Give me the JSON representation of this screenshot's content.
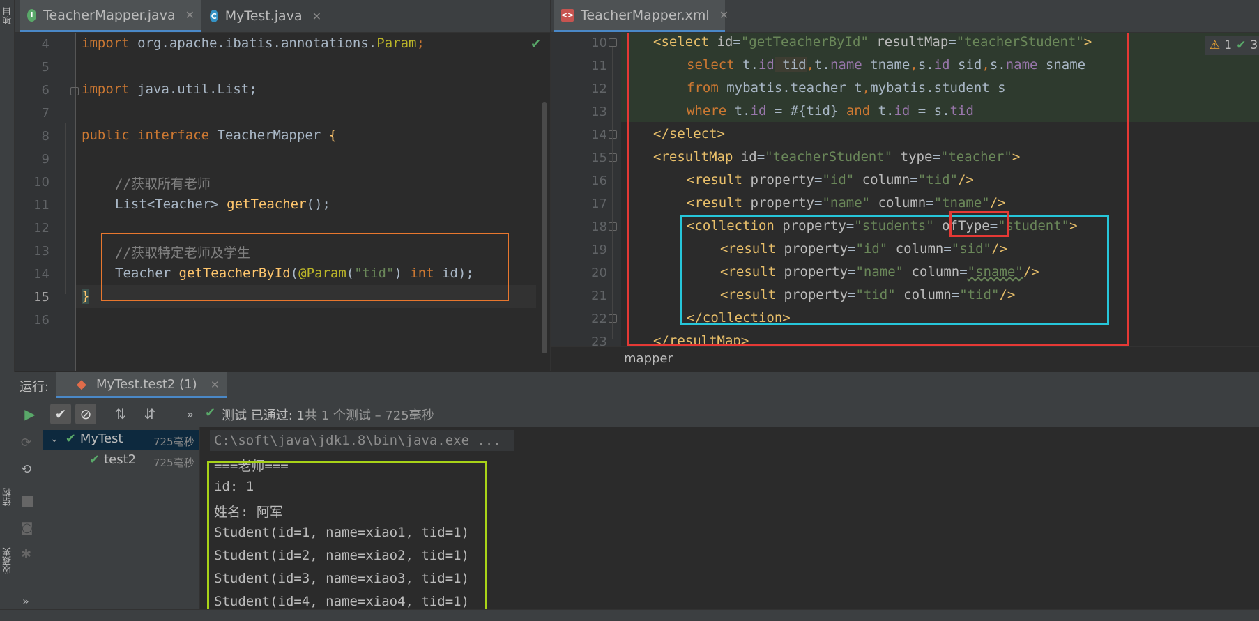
{
  "left_strip": {
    "top_label": "项目",
    "mid_label": "结构",
    "bottom_label": "收藏夹"
  },
  "left_editor": {
    "tabs": [
      {
        "label": "TeacherMapper.java",
        "badge": "I",
        "badge_color": "#59a869"
      },
      {
        "label": "MyTest.java",
        "badge": "C",
        "badge_color": "#3592c4"
      }
    ],
    "lines": [
      {
        "n": "4"
      },
      {
        "n": "5"
      },
      {
        "n": "6"
      },
      {
        "n": "7"
      },
      {
        "n": "8"
      },
      {
        "n": "9"
      },
      {
        "n": "10"
      },
      {
        "n": "11"
      },
      {
        "n": "12"
      },
      {
        "n": "13"
      },
      {
        "n": "14"
      },
      {
        "n": "15"
      },
      {
        "n": "16"
      }
    ],
    "code": {
      "l4_kw": "import",
      "l4_pkg": " org.apache.ibatis.annotations.",
      "l4_cls": "Param",
      "l4_semi": ";",
      "l6_kw": "import",
      "l6_rest": " java.util.List;",
      "l8_kw1": "public",
      "l8_kw2": "interface",
      "l8_name": " TeacherMapper ",
      "l8_brace": "{",
      "l10_cmt": "//获取所有老师",
      "l11_type": "List<Teacher> ",
      "l11_fn": "getTeacher",
      "l11_rest": "();",
      "l13_cmt": "//获取特定老师及学生",
      "l14_type": "Teacher ",
      "l14_fn": "getTeacherById",
      "l14_p1": "(",
      "l14_ann": "@Param",
      "l14_p2": "(",
      "l14_str": "\"tid\"",
      "l14_p3": ") ",
      "l14_kw": "int",
      "l14_rest": " id);",
      "l15_brace": "}"
    }
  },
  "right_editor": {
    "tab": {
      "label": "TeacherMapper.xml"
    },
    "inspections": {
      "warnings": "1",
      "passed": "3"
    },
    "lines": [
      {
        "n": "10"
      },
      {
        "n": "11"
      },
      {
        "n": "12"
      },
      {
        "n": "13"
      },
      {
        "n": "14"
      },
      {
        "n": "15"
      },
      {
        "n": "16"
      },
      {
        "n": "17"
      },
      {
        "n": "18"
      },
      {
        "n": "19"
      },
      {
        "n": "20"
      },
      {
        "n": "21"
      },
      {
        "n": "22"
      },
      {
        "n": "23"
      }
    ],
    "code": {
      "r10": [
        "<select ",
        "id",
        "=",
        "\"getTeacherById\"",
        " resultMap",
        "=",
        "\"teacherStudent\"",
        ">"
      ],
      "r11": [
        "select ",
        "t.",
        "id",
        " tid",
        ",",
        "t.",
        "name",
        " tname",
        ",",
        "s.",
        "id",
        " sid",
        ",",
        "s.",
        "name",
        " sname"
      ],
      "r12": [
        "from ",
        "mybatis.teacher t",
        ",",
        "mybatis.student s"
      ],
      "r13": [
        "where ",
        "t.",
        "id",
        " = #{tid} ",
        "and ",
        "t.",
        "id",
        " = s.",
        "tid"
      ],
      "r14": "</select>",
      "r15": [
        "<resultMap ",
        "id",
        "=",
        "\"teacherStudent\"",
        " type",
        "=",
        "\"teacher\"",
        ">"
      ],
      "r16": [
        "<result ",
        "property",
        "=",
        "\"id\"",
        " column",
        "=",
        "\"tid\"",
        "/>"
      ],
      "r17": [
        "<result ",
        "property",
        "=",
        "\"name\"",
        " column",
        "=",
        "\"tname\"",
        "/>"
      ],
      "r18": [
        "<collection ",
        "property",
        "=",
        "\"students\"",
        " ofType",
        "=",
        "\"student\"",
        ">"
      ],
      "r19": [
        "<result ",
        "property",
        "=",
        "\"id\"",
        " column",
        "=",
        "\"sid\"",
        "/>"
      ],
      "r20": [
        "<result ",
        "property",
        "=",
        "\"name\"",
        " column",
        "=",
        "\"sname\"",
        "/>"
      ],
      "r21": [
        "<result ",
        "property",
        "=",
        "\"tid\"",
        " column",
        "=",
        "\"tid\"",
        "/>"
      ],
      "r22": "</collection>",
      "r23": "</resultMap>"
    },
    "breadcrumb": "mapper"
  },
  "run_panel": {
    "label": "运行:",
    "config_tab": "MyTest.test2 (1)",
    "status_text_1": "测试 已通过: ",
    "status_count": "1",
    "status_text_2": "共 1 个测试 – 725毫秒",
    "tree": [
      {
        "label": "MyTest",
        "time": "725毫秒"
      },
      {
        "label": "test2",
        "time": "725毫秒"
      }
    ],
    "console": [
      "C:\\soft\\java\\jdk1.8\\bin\\java.exe ...",
      "===老师===",
      "id: 1",
      "姓名: 阿军",
      "Student(id=1, name=xiao1, tid=1)",
      "Student(id=2, name=xiao2, tid=1)",
      "Student(id=3, name=xiao3, tid=1)",
      "Student(id=4, name=xiao4, tid=1)"
    ]
  },
  "colors": {
    "orange_box": "#e8772e",
    "red_box": "#e53935",
    "cyan_box": "#26c6da",
    "green_box": "#a8d318",
    "pass_green": "#59a869"
  }
}
